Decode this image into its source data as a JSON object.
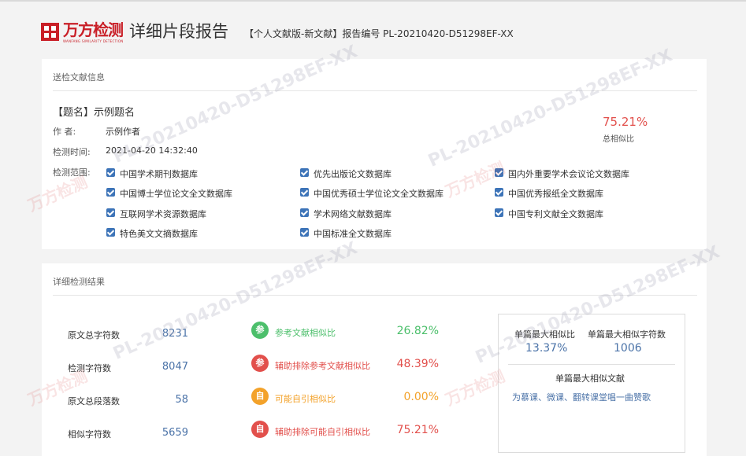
{
  "header": {
    "logo_text": "万方检测",
    "logo_sub": "WANFANG SIMILARITY DETECTION",
    "title": "详细片段报告",
    "meta": "【个人文献版-新文献】报告编号 PL-20210420-D51298EF-XX"
  },
  "watermark": {
    "code": "PL-20210420-D51298EF-XX",
    "brand": "万方检测"
  },
  "doc_info": {
    "section_title": "送检文献信息",
    "title_label": "【题名】",
    "title_value": "示例题名",
    "author_label": "作      者:",
    "author_value": "示例作者",
    "time_label": "检测时间:",
    "time_value": "2021-04-20 14:32:40",
    "scope_label": "检测范围:",
    "similarity_pct": "75.21%",
    "similarity_label": "总相似比",
    "databases": [
      "中国学术期刊数据库",
      "优先出版论文数据库",
      "国内外重要学术会议论文数据库",
      "中国博士学位论文全文数据库",
      "中国优秀硕士学位论文全文数据库",
      "中国优秀报纸全文数据库",
      "互联网学术资源数据库",
      "学术网络文献数据库",
      "中国专利文献全文数据库",
      "特色美文文摘数据库",
      "中国标准全文数据库"
    ],
    "checked_color": "#3d74b8"
  },
  "results": {
    "section_title": "详细检测结果",
    "stats": [
      {
        "label": "原文总字符数",
        "value": "8231"
      },
      {
        "label": "检测字符数",
        "value": "8047"
      },
      {
        "label": "原文总段落数",
        "value": "58"
      },
      {
        "label": "相似字符数",
        "value": "5659"
      }
    ],
    "metrics": [
      {
        "badge": "参",
        "label": "参考文献相似比",
        "value": "26.82%",
        "color": "#4cbf6b"
      },
      {
        "badge": "参",
        "label": "辅助排除参考文献相似比",
        "value": "48.39%",
        "color": "#e2504c"
      },
      {
        "badge": "自",
        "label": "可能自引相似比",
        "value": "0.00%",
        "color": "#f3a22a"
      },
      {
        "badge": "自",
        "label": "辅助排除可能自引相似比",
        "value": "75.21%",
        "color": "#e2504c"
      }
    ],
    "single": {
      "max_ratio_label": "单篇最大相似比",
      "max_ratio_value": "13.37%",
      "max_chars_label": "单篇最大相似字符数",
      "max_chars_value": "1006",
      "max_doc_label": "单篇最大相似文献",
      "max_doc_value": "为慕课、微课、翻转课堂唱一曲赞歌"
    }
  }
}
